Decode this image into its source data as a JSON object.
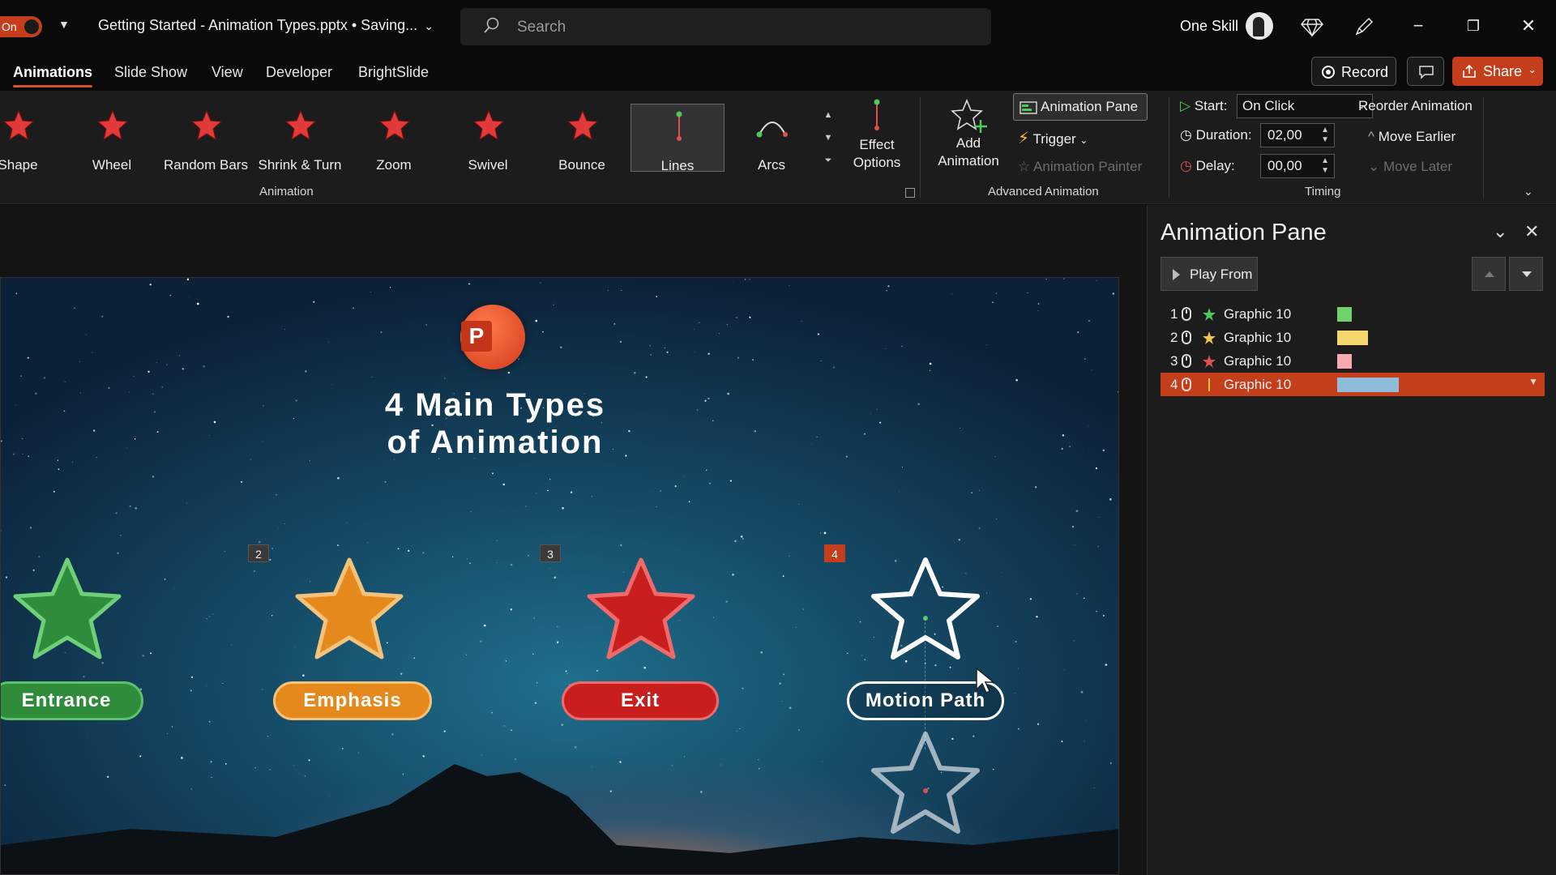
{
  "titlebar": {
    "autosave_label": "On",
    "document_title": "Getting Started - Animation Types.pptx • Saving...",
    "search_placeholder": "Search",
    "user_name": "One Skill",
    "minimize": "−",
    "restore": "❐",
    "close": "✕"
  },
  "tabs": [
    {
      "label": "Animations",
      "active": true
    },
    {
      "label": "Slide Show"
    },
    {
      "label": "View"
    },
    {
      "label": "Developer"
    },
    {
      "label": "BrightSlide"
    }
  ],
  "toolbar": {
    "record_label": "Record",
    "share_label": "Share"
  },
  "ribbon": {
    "animation_gallery": [
      {
        "label": "Shape",
        "icon": "shape-star-icon"
      },
      {
        "label": "Wheel",
        "icon": "wheel-star-icon"
      },
      {
        "label": "Random Bars",
        "icon": "random-bars-star-icon"
      },
      {
        "label": "Shrink & Turn",
        "icon": "shrink-turn-star-icon"
      },
      {
        "label": "Zoom",
        "icon": "zoom-star-icon"
      },
      {
        "label": "Swivel",
        "icon": "swivel-star-icon"
      },
      {
        "label": "Bounce",
        "icon": "bounce-star-icon"
      },
      {
        "label": "Lines",
        "icon": "lines-path-icon",
        "selected": true
      },
      {
        "label": "Arcs",
        "icon": "arcs-path-icon"
      }
    ],
    "effect_options_label": "Effect\nOptions",
    "animation_group_label": "Animation",
    "add_animation_label": "Add\nAnimation",
    "animation_pane_label": "Animation Pane",
    "trigger_label": "Trigger",
    "animation_painter_label": "Animation Painter",
    "advanced_group_label": "Advanced Animation",
    "start_label": "Start:",
    "start_value": "On Click",
    "duration_label": "Duration:",
    "duration_value": "02,00",
    "delay_label": "Delay:",
    "delay_value": "00,00",
    "timing_group_label": "Timing",
    "reorder_label": "Reorder Animation",
    "move_earlier_label": "Move Earlier",
    "move_later_label": "Move Later"
  },
  "slide": {
    "logo_letter": "P",
    "title": "4 Main Types\nof Animation",
    "items": [
      {
        "label": "Entrance",
        "tag": ""
      },
      {
        "label": "Emphasis",
        "tag": "2"
      },
      {
        "label": "Exit",
        "tag": "3"
      },
      {
        "label": "Motion Path",
        "tag": "4"
      }
    ]
  },
  "animation_pane": {
    "title": "Animation Pane",
    "play_from_label": "Play From",
    "items": [
      {
        "num": "1",
        "name": "Graphic 10",
        "color": "#6fd36a",
        "effect_icon": "entrance-effect-icon"
      },
      {
        "num": "2",
        "name": "Graphic 10",
        "color": "#f5d76e",
        "effect_icon": "emphasis-effect-icon"
      },
      {
        "num": "3",
        "name": "Graphic 10",
        "color": "#f7a9ad",
        "effect_icon": "exit-effect-icon"
      },
      {
        "num": "4",
        "name": "Graphic 10",
        "color": "#8fbcd9",
        "effect_icon": "motion-path-effect-icon",
        "selected": true
      }
    ]
  },
  "colors": {
    "accent": "#c43e1c",
    "entrance": "#2f8c3a",
    "emphasis": "#e6891d",
    "exit": "#c81e1e"
  }
}
